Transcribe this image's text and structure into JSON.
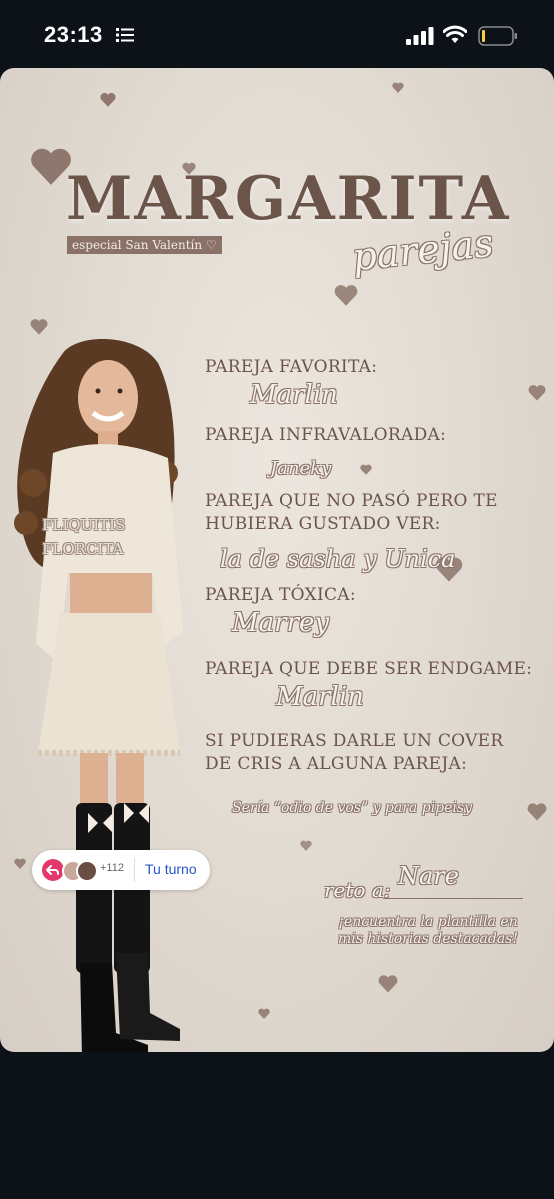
{
  "status_bar": {
    "time": "23:13"
  },
  "story": {
    "title": "MARGARITA",
    "badge": "especial San Valentín ♡",
    "subtitle": "parejas",
    "overlay_lines": [
      "FLIQUITIS",
      "FLORCITA"
    ],
    "questions": [
      {
        "label": "PAREJA FAVORITA:",
        "answer": "Marlin"
      },
      {
        "label": "PAREJA INFRAVALORADA:",
        "answer": "Janeky"
      },
      {
        "label_line1": "PAREJA QUE NO PASÓ PERO TE",
        "label_line2": "HUBIERA GUSTADO VER:",
        "answer": "la de sasha y Unica"
      },
      {
        "label": "PAREJA TÓXICA:",
        "answer": "Marrey"
      },
      {
        "label": "PAREJA QUE DEBE SER ENDGAME:",
        "answer": "Marlin"
      },
      {
        "label_line1": "SI PUDIERAS DARLE UN COVER",
        "label_line2": "DE CRIS A ALGUNA PAREJA:",
        "answer": "Sería “odio de vos” y para pipeisy"
      }
    ],
    "reto_label": "reto a:",
    "reto_value": "Nare",
    "footer_line1": "¡encuentra la plantilla en",
    "footer_line2": "mis historias destacadas!"
  },
  "reply_bar": {
    "count": "+112",
    "turn_label": "Tu turno"
  },
  "colors": {
    "accent": "#6b544a",
    "button_text": "#2456c7",
    "reply_red": "#e2396a"
  }
}
